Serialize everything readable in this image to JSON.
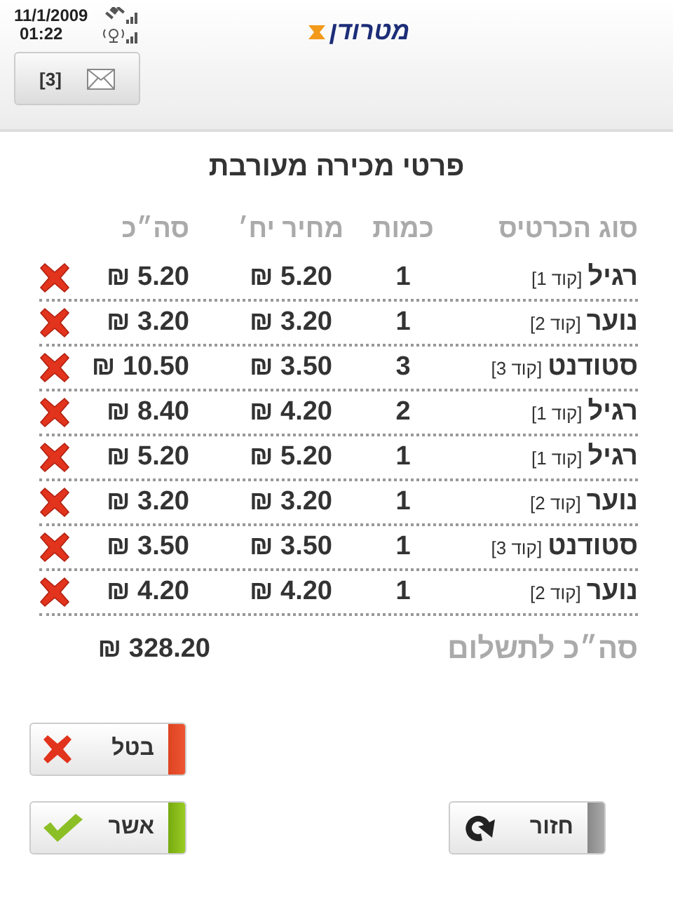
{
  "status_bar": {
    "date": "11/1/2009",
    "time": "01:22"
  },
  "mail_button": {
    "count": "[3]"
  },
  "logo": {
    "text": "מטרודן"
  },
  "title": "פרטי מכירה מעורבת",
  "table": {
    "columns": [
      "סוג הכרטיס",
      "כמות",
      "מחיר יח׳",
      "סה״כ"
    ],
    "rows": [
      {
        "type": "רגיל",
        "code": "[קוד 1]",
        "quantity": "1",
        "unit_price": "5.20 ₪",
        "total": "5.20 ₪"
      },
      {
        "type": "נוער",
        "code": "[קוד 2]",
        "quantity": "1",
        "unit_price": "3.20 ₪",
        "total": "3.20 ₪"
      },
      {
        "type": "סטודנט",
        "code": "[קוד 3]",
        "quantity": "3",
        "unit_price": "3.50 ₪",
        "total": "10.50 ₪"
      },
      {
        "type": "רגיל",
        "code": "[קוד 1]",
        "quantity": "2",
        "unit_price": "4.20 ₪",
        "total": "8.40 ₪"
      },
      {
        "type": "רגיל",
        "code": "[קוד 1]",
        "quantity": "1",
        "unit_price": "5.20 ₪",
        "total": "5.20 ₪"
      },
      {
        "type": "נוער",
        "code": "[קוד 2]",
        "quantity": "1",
        "unit_price": "3.20 ₪",
        "total": "3.20 ₪"
      },
      {
        "type": "סטודנט",
        "code": "[קוד 3]",
        "quantity": "1",
        "unit_price": "3.50 ₪",
        "total": "3.50 ₪"
      },
      {
        "type": "נוער",
        "code": "[קוד 2]",
        "quantity": "1",
        "unit_price": "4.20 ₪",
        "total": "4.20 ₪"
      }
    ]
  },
  "grand_total": {
    "label": "סה״כ לתשלום",
    "value": "328.20 ₪"
  },
  "buttons": [
    {
      "label": "בטל",
      "kind": "cancel"
    },
    {
      "label": "אשר",
      "kind": "confirm"
    },
    {
      "label": "חזור",
      "kind": "back"
    }
  ]
}
